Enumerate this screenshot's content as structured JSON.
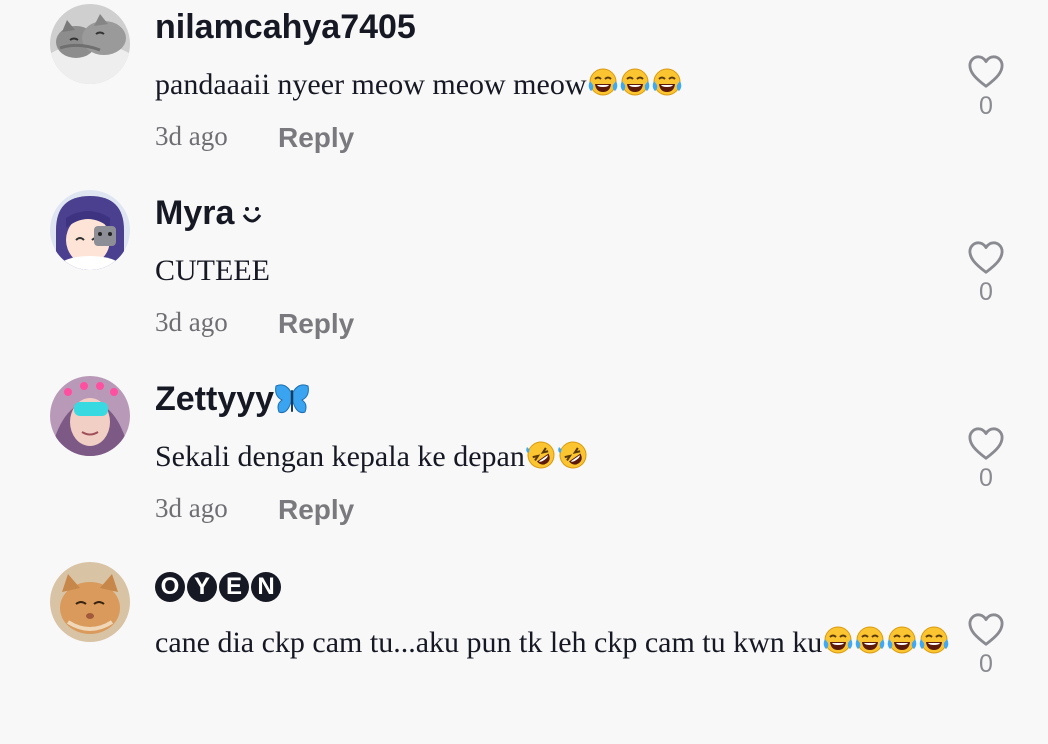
{
  "comments": [
    {
      "username": "nilamcahya7405",
      "text": "pandaaaii nyeer meow meow meow",
      "emojis": [
        "joy-emoji",
        "joy-emoji",
        "joy-emoji"
      ],
      "time": "3d ago",
      "reply_label": "Reply",
      "likes": "0"
    },
    {
      "username": "Myra",
      "username_decoration": "smile-icon",
      "text": "CUTEEE",
      "time": "3d ago",
      "reply_label": "Reply",
      "likes": "0"
    },
    {
      "username": "Zettyyy",
      "username_decoration": "butterfly-emoji",
      "text": "Sekali dengan kepala ke depan",
      "emojis": [
        "rofl-emoji",
        "rofl-emoji"
      ],
      "time": "3d ago",
      "reply_label": "Reply",
      "likes": "0"
    },
    {
      "username_letters": [
        "O",
        "Y",
        "E",
        "N"
      ],
      "text": "cane dia ckp cam tu...aku pun tk leh ckp cam tu kwn ku",
      "emojis": [
        "joy-emoji",
        "joy-emoji",
        "joy-emoji",
        "joy-emoji"
      ],
      "likes": "0"
    }
  ],
  "icons": {
    "like": "heart-outline-icon"
  },
  "colors": {
    "background": "#f8f8f8",
    "username": "#161823",
    "meta": "#6e6e73",
    "reply": "#7a7a7e",
    "like_icon": "#8a8b91",
    "emoji_face": "#fbc531",
    "tear": "#3fa9f5",
    "butterfly": "#3aa4f0"
  }
}
